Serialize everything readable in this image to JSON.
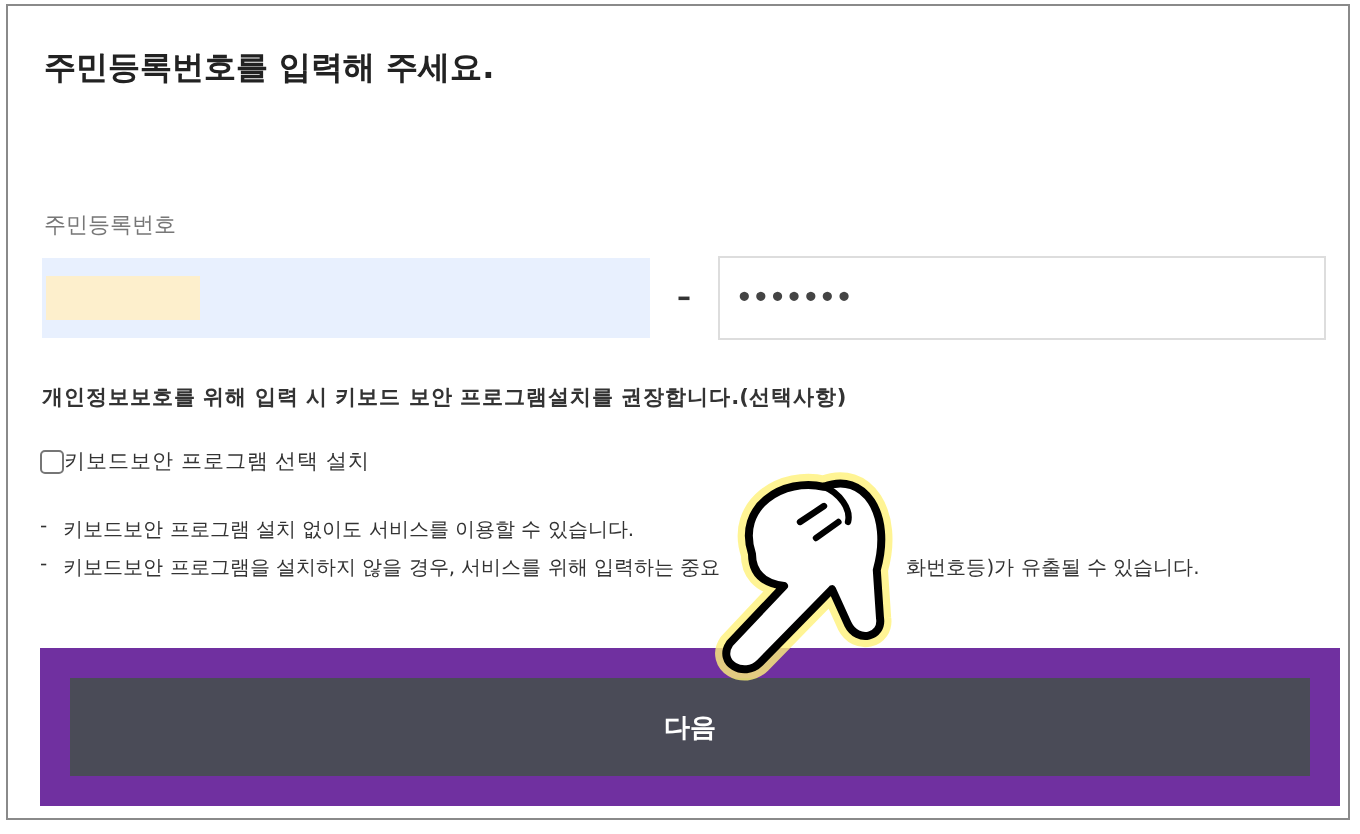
{
  "title": "주민등록번호를 입력해 주세요.",
  "field_label": "주민등록번호",
  "id_front": {
    "masked": true
  },
  "separator": "–",
  "id_back": {
    "value": "•••••••"
  },
  "notice": "개인정보보호를 위해 입력 시 키보드 보안 프로그램설치를 권장합니다.(선택사항)",
  "install_option": {
    "label": "키보드보안 프로그램 선택 설치",
    "checked": false
  },
  "notes": [
    {
      "bullet": "-",
      "parts": [
        "키보드보안 프로그램 설치 없이도 서비스를 이용할 수 있습니다."
      ]
    },
    {
      "bullet": "-",
      "parts": [
        "키보드보안 프로그램을 설치하지 않을 경우, 서비스를 위해 입력하는 중요",
        "화번호등)가 유출될 수 있습니다."
      ]
    }
  ],
  "next_button": "다음"
}
